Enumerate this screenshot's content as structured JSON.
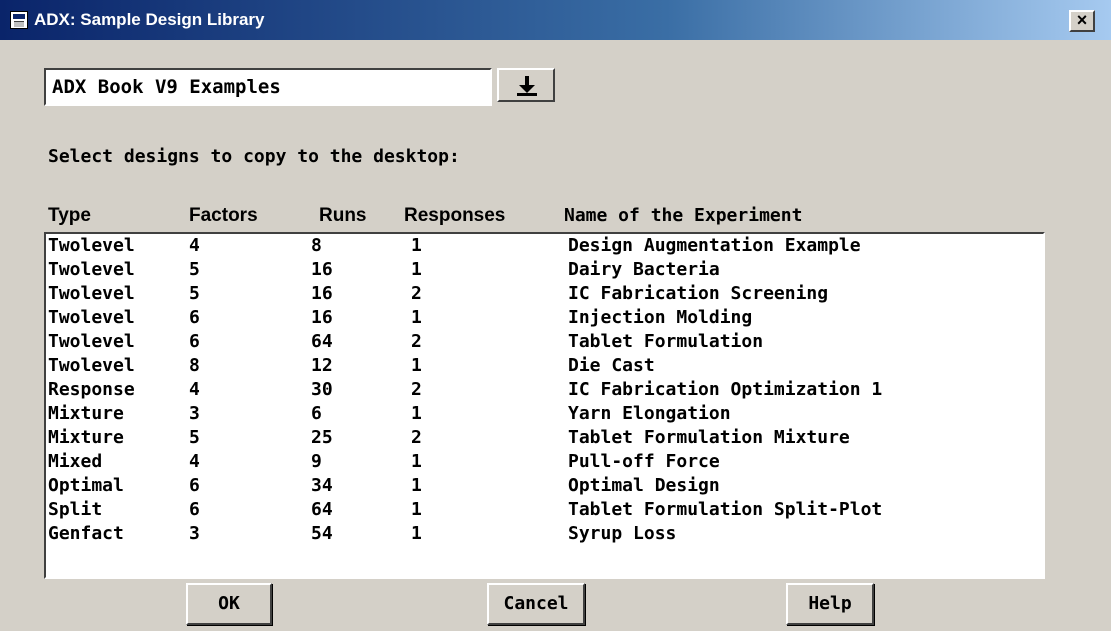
{
  "window": {
    "title": "ADX: Sample Design Library",
    "close_label": "×"
  },
  "library": {
    "selected": "ADX Book V9 Examples",
    "dropdown_icon": "arrow-down-to-line-icon"
  },
  "prompt": "Select designs to copy to the desktop:",
  "columns": {
    "type": "Type",
    "factors": "Factors",
    "runs": "Runs",
    "responses": "Responses",
    "name": "Name of the Experiment"
  },
  "rows": [
    {
      "type": "Twolevel",
      "factors": "4",
      "runs": "8",
      "responses": "1",
      "name": "Design Augmentation Example"
    },
    {
      "type": "Twolevel",
      "factors": "5",
      "runs": "16",
      "responses": "1",
      "name": "Dairy Bacteria"
    },
    {
      "type": "Twolevel",
      "factors": "5",
      "runs": "16",
      "responses": "2",
      "name": "IC Fabrication Screening"
    },
    {
      "type": "Twolevel",
      "factors": "6",
      "runs": "16",
      "responses": "1",
      "name": "Injection Molding"
    },
    {
      "type": "Twolevel",
      "factors": "6",
      "runs": "64",
      "responses": "2",
      "name": "Tablet Formulation"
    },
    {
      "type": "Twolevel",
      "factors": "8",
      "runs": "12",
      "responses": "1",
      "name": "Die Cast"
    },
    {
      "type": "Response",
      "factors": "4",
      "runs": "30",
      "responses": "2",
      "name": "IC Fabrication Optimization 1"
    },
    {
      "type": "Mixture",
      "factors": "3",
      "runs": "6",
      "responses": "1",
      "name": "Yarn Elongation"
    },
    {
      "type": "Mixture",
      "factors": "5",
      "runs": "25",
      "responses": "2",
      "name": "Tablet Formulation Mixture"
    },
    {
      "type": "Mixed",
      "factors": "4",
      "runs": "9",
      "responses": "1",
      "name": "Pull-off Force"
    },
    {
      "type": "Optimal",
      "factors": "6",
      "runs": "34",
      "responses": "1",
      "name": "Optimal Design"
    },
    {
      "type": "Split",
      "factors": "6",
      "runs": "64",
      "responses": "1",
      "name": "Tablet Formulation Split-Plot"
    },
    {
      "type": "Genfact",
      "factors": "3",
      "runs": "54",
      "responses": "1",
      "name": "Syrup Loss"
    }
  ],
  "buttons": {
    "ok": "OK",
    "cancel": "Cancel",
    "help": "Help"
  },
  "colors": {
    "title_bar_start": "#0a246a",
    "title_bar_end": "#a6caf0",
    "dialog_face": "#d4d0c8",
    "list_background": "#ffffff"
  }
}
